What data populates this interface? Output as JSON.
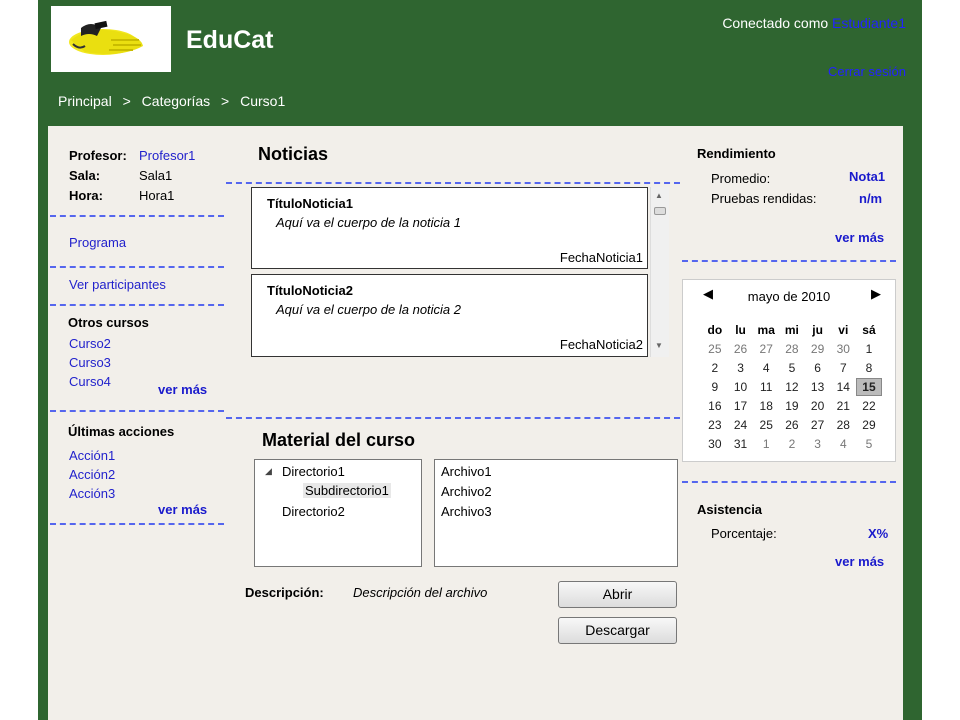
{
  "header": {
    "app_title": "EduCat",
    "session_prefix": "Conectado como",
    "session_user": "Estudiante1",
    "logout": "Cerrar sesión"
  },
  "breadcrumb": [
    "Principal",
    ">",
    "Categorías",
    ">",
    "Curso1"
  ],
  "left": {
    "profesor_label": "Profesor:",
    "profesor_value": "Profesor1",
    "sala_label": "Sala:",
    "sala_value": "Sala1",
    "hora_label": "Hora:",
    "hora_value": "Hora1",
    "programa": "Programa",
    "participantes": "Ver participantes",
    "otros_title": "Otros cursos",
    "otros": [
      "Curso2",
      "Curso3",
      "Curso4"
    ],
    "otros_more": "ver más",
    "acciones_title": "Últimas acciones",
    "acciones": [
      "Acción1",
      "Acción2",
      "Acción3"
    ],
    "acciones_more": "ver más"
  },
  "news": {
    "title": "Noticias",
    "items": [
      {
        "title": "TítuloNoticia1",
        "body": "Aquí va el cuerpo de la noticia 1",
        "date": "FechaNoticia1"
      },
      {
        "title": "TítuloNoticia2",
        "body": "Aquí va el cuerpo de la noticia 2",
        "date": "FechaNoticia2"
      }
    ]
  },
  "material": {
    "title": "Material del curso",
    "tree": [
      "Directorio1",
      "Subdirectorio1",
      "Directorio2"
    ],
    "files": [
      "Archivo1",
      "Archivo2",
      "Archivo3"
    ],
    "desc_label": "Descripción:",
    "desc_value": "Descripción del archivo",
    "open": "Abrir",
    "download": "Descargar"
  },
  "rendimiento": {
    "title": "Rendimiento",
    "promedio_label": "Promedio:",
    "promedio_value": "Nota1",
    "pruebas_label": "Pruebas rendidas:",
    "pruebas_value": "n/m",
    "more": "ver más"
  },
  "calendar": {
    "month": "mayo de 2010",
    "days_of_week": [
      "do",
      "lu",
      "ma",
      "mi",
      "ju",
      "vi",
      "sá"
    ],
    "weeks": [
      [
        "25",
        "26",
        "27",
        "28",
        "29",
        "30",
        "1"
      ],
      [
        "2",
        "3",
        "4",
        "5",
        "6",
        "7",
        "8"
      ],
      [
        "9",
        "10",
        "11",
        "12",
        "13",
        "14",
        "15"
      ],
      [
        "16",
        "17",
        "18",
        "19",
        "20",
        "21",
        "22"
      ],
      [
        "23",
        "24",
        "25",
        "26",
        "27",
        "28",
        "29"
      ],
      [
        "30",
        "31",
        "1",
        "2",
        "3",
        "4",
        "5"
      ]
    ],
    "selected": "15"
  },
  "asistencia": {
    "title": "Asistencia",
    "porcentaje_label": "Porcentaje:",
    "porcentaje_value": "X%",
    "more": "ver más"
  },
  "colors": {
    "frame": "#2f6530",
    "link": "#2222cc",
    "dash": "#5566ee",
    "panel": "#f2efea"
  }
}
